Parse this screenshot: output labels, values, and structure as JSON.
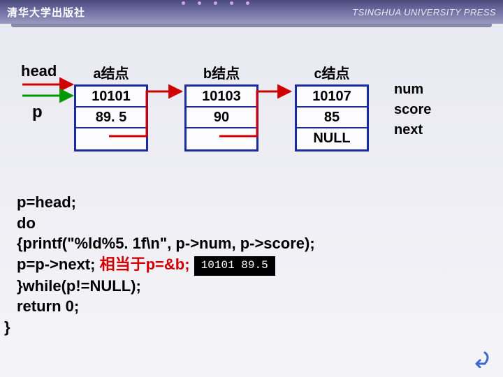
{
  "brand": {
    "zh": "清华大学出版社",
    "en": "TSINGHUA UNIVERSITY PRESS"
  },
  "pointers": {
    "head": "head",
    "p": "p"
  },
  "field_labels": {
    "num": "num",
    "score": "score",
    "next": "next"
  },
  "nodes": {
    "a": {
      "label": "a结点",
      "num": "10101",
      "score": "89. 5"
    },
    "b": {
      "label": "b结点",
      "num": "10103",
      "score": "90"
    },
    "c": {
      "label": "c结点",
      "num": "10107",
      "score": "85",
      "next": "NULL"
    }
  },
  "code": {
    "l1": "p=head;",
    "l2": "do",
    "l3": "{printf(\"%ld%5. 1f\\n\", p->num, p->score);",
    "l4a": " p=p->next;  ",
    "l4_red": "相当于p=&b;",
    "l5": " }while(p!=NULL);",
    "l6": "return 0;",
    "l7": "}"
  },
  "console": {
    "line": "10101   89.5"
  },
  "icons": {
    "back": "back-arrow"
  }
}
